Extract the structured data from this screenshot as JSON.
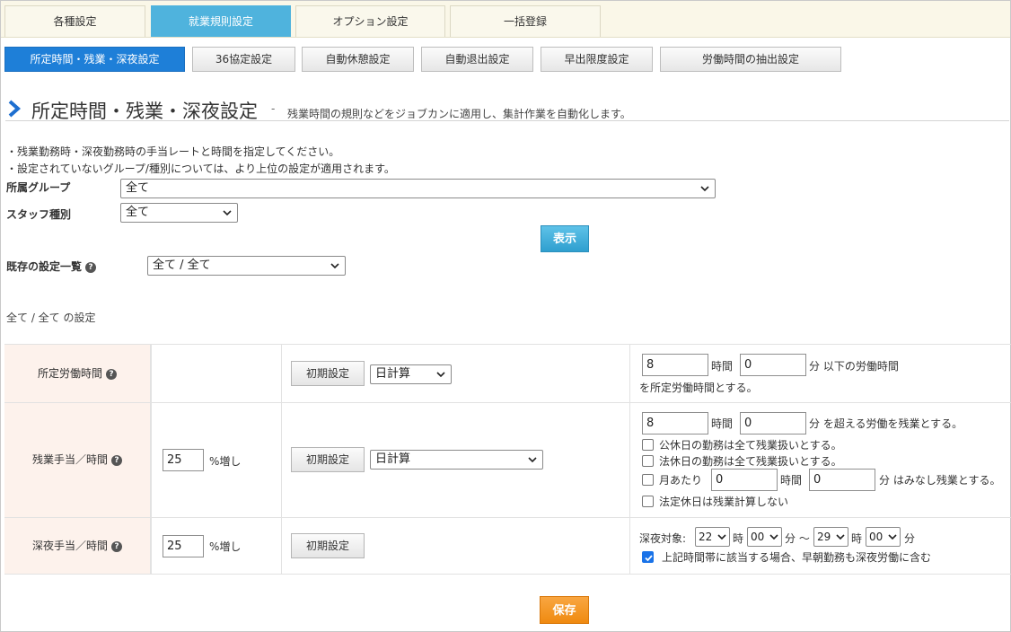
{
  "top_tabs": [
    {
      "label": "各種設定"
    },
    {
      "label": "就業規則設定"
    },
    {
      "label": "オプション設定"
    },
    {
      "label": "一括登録"
    }
  ],
  "sub_tabs": [
    {
      "label": "所定時間・残業・深夜設定"
    },
    {
      "label": "36協定設定"
    },
    {
      "label": "自動休憩設定"
    },
    {
      "label": "自動退出設定"
    },
    {
      "label": "早出限度設定"
    },
    {
      "label": "労働時間の抽出設定"
    }
  ],
  "heading": {
    "title": "所定時間・残業・深夜設定",
    "separator": "-",
    "description": "残業時間の規則などをジョブカンに適用し、集計作業を自動化します。"
  },
  "notes": [
    "・残業勤務時・深夜勤務時の手当レートと時間を指定してください。",
    "・設定されていないグループ/種別については、より上位の設定が適用されます。"
  ],
  "filters": {
    "group_label": "所属グループ",
    "group_value": "全て",
    "staff_label": "スタッフ種別",
    "staff_value": "全て",
    "show_button": "表示",
    "existing_label": "既存の設定一覧",
    "existing_value": "全て / 全て"
  },
  "section_title": "全て / 全て の設定",
  "rows": {
    "prescribed": {
      "label": "所定労働時間",
      "init_button": "初期設定",
      "calc_value": "日計算",
      "hours": "8",
      "hours_unit": "時間",
      "minutes": "0",
      "minutes_suffix": "分 以下の労働時間",
      "line2": "を所定労働時間とする。"
    },
    "overtime": {
      "label": "残業手当／時間",
      "rate": "25",
      "rate_unit": "%増し",
      "init_button": "初期設定",
      "calc_value": "日計算",
      "hours": "8",
      "hours_unit": "時間",
      "minutes": "0",
      "minutes_suffix": "分 を超える労働を残業とする。",
      "check1": "公休日の勤務は全て残業扱いとする。",
      "check2": "法休日の勤務は全て残業扱いとする。",
      "monthly_prefix": "月あたり",
      "monthly_hours": "0",
      "monthly_hours_unit": "時間",
      "monthly_minutes": "0",
      "monthly_suffix": "分 はみなし残業とする。",
      "check4": "法定休日は残業計算しない"
    },
    "night": {
      "label": "深夜手当／時間",
      "rate": "25",
      "rate_unit": "%増し",
      "init_button": "初期設定",
      "target_label": "深夜対象:",
      "start_hour": "22",
      "hour_unit": "時",
      "start_min": "00",
      "min_unit_tilde": "分 〜",
      "end_hour": "29",
      "end_min": "00",
      "min_unit": "分",
      "check_label": "上記時間帯に該当する場合、早朝勤務も深夜労働に含む"
    }
  },
  "save_button": "保存",
  "colors": {
    "active_tab": "#4fb3dd",
    "active_subtab": "#1e7fd8",
    "show_button": "#3aaedb",
    "save_button": "#f29b2a",
    "row_header_bg": "#fdf2ec",
    "heading_chevron": "#1e6fd0"
  }
}
